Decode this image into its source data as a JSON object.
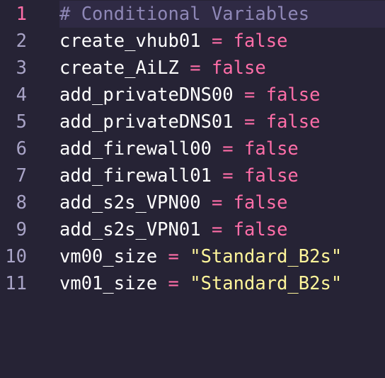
{
  "colors": {
    "background": "#262335",
    "line_number": "#a9a4c7",
    "current_line_number": "#ff6ea8",
    "comment": "#8e87b6",
    "variable": "#ffffff",
    "operator": "#ff6ea8",
    "boolean": "#ff6ea8",
    "string": "#fff59a"
  },
  "lines": [
    {
      "num": "1",
      "comment": "# Conditional Variables"
    },
    {
      "num": "2",
      "var": "create_vhub01",
      "op": "=",
      "value": "false"
    },
    {
      "num": "3",
      "var": "create_AiLZ",
      "op": "=",
      "value": "false"
    },
    {
      "num": "4",
      "var": "add_privateDNS00",
      "op": "=",
      "value": "false"
    },
    {
      "num": "5",
      "var": "add_privateDNS01",
      "op": "=",
      "value": "false"
    },
    {
      "num": "6",
      "var": "add_firewall00",
      "op": "=",
      "value": "false"
    },
    {
      "num": "7",
      "var": "add_firewall01",
      "op": "=",
      "value": "false"
    },
    {
      "num": "8",
      "var": "add_s2s_VPN00",
      "op": "=",
      "value": "false"
    },
    {
      "num": "9",
      "var": "add_s2s_VPN01",
      "op": "=",
      "value": "false"
    },
    {
      "num": "10",
      "var": "vm00_size",
      "op": "=",
      "value": "\"Standard_B2s\""
    },
    {
      "num": "11",
      "var": "vm01_size",
      "op": "=",
      "value": "\"Standard_B2s\""
    }
  ]
}
